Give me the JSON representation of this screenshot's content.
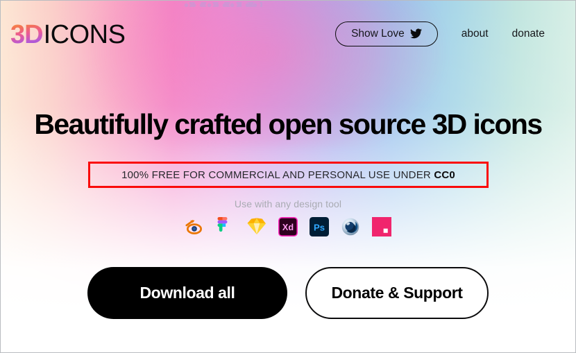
{
  "site": {
    "logo_prefix": "3D",
    "logo_suffix": "ICONS"
  },
  "nav": {
    "show_love_label": "Show Love",
    "show_love_icon": "twitter-bird-icon",
    "links": [
      {
        "label": "about"
      },
      {
        "label": "donate"
      }
    ]
  },
  "hero": {
    "headline": "Beautifully crafted open source 3D icons",
    "license_prefix": "100% FREE FOR COMMERCIAL AND PERSONAL USE UNDER ",
    "license_highlight": "CC0",
    "license_box_color": "#fa0b0b",
    "tools_caption": "Use with any design tool"
  },
  "tools": [
    {
      "name": "blender-icon",
      "label": "Blender",
      "color": "#e87d0d"
    },
    {
      "name": "figma-icon",
      "label": "Figma",
      "color": "#f24e1e"
    },
    {
      "name": "sketch-icon",
      "label": "Sketch",
      "color": "#fdb300"
    },
    {
      "name": "adobe-xd-icon",
      "label": "Adobe Xd",
      "color": "#ff61f6"
    },
    {
      "name": "photoshop-icon",
      "label": "Adobe Photoshop",
      "color": "#31a8ff"
    },
    {
      "name": "cinema4d-icon",
      "label": "Cinema 4D",
      "color": "#0d5ca6"
    },
    {
      "name": "invision-icon",
      "label": "InVision Studio",
      "color": "#f0256d"
    }
  ],
  "cta": {
    "download_label": "Download all",
    "donate_label": "Donate & Support"
  },
  "theme": {
    "background_left": "#fde7d4",
    "background_pink": "#f287c9",
    "background_purple": "#c79ce8",
    "background_blue": "#9cc3ee",
    "background_right": "#d7efe6",
    "text_primary": "#000000",
    "button_primary_bg": "#000000",
    "button_primary_text": "#ffffff"
  }
}
